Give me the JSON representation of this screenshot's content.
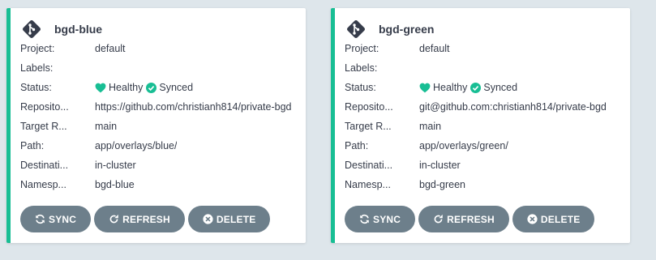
{
  "colors": {
    "background": "#dee6eb",
    "card": "#ffffff",
    "accent": "#18be94",
    "button": "#6d7f8b",
    "text": "#363c4a"
  },
  "field_labels": {
    "project": "Project:",
    "labels": "Labels:",
    "status": "Status:",
    "repository": "Reposito...",
    "target_revision": "Target R...",
    "path": "Path:",
    "destination": "Destinati...",
    "namespace": "Namesp..."
  },
  "buttons": {
    "sync": "SYNC",
    "refresh": "REFRESH",
    "delete": "DELETE"
  },
  "apps": [
    {
      "icon": "git-icon",
      "title": "bgd-blue",
      "project": "default",
      "labels": "",
      "health": "Healthy",
      "sync": "Synced",
      "repository": "https://github.com/christianh814/private-bgd",
      "target_revision": "main",
      "path": "app/overlays/blue/",
      "destination": "in-cluster",
      "namespace": "bgd-blue"
    },
    {
      "icon": "git-icon",
      "title": "bgd-green",
      "project": "default",
      "labels": "",
      "health": "Healthy",
      "sync": "Synced",
      "repository": "git@github.com:christianh814/private-bgd",
      "target_revision": "main",
      "path": "app/overlays/green/",
      "destination": "in-cluster",
      "namespace": "bgd-green"
    }
  ]
}
